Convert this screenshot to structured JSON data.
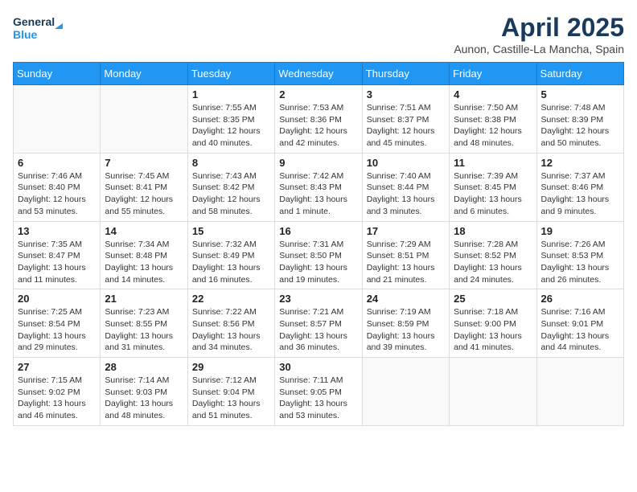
{
  "header": {
    "logo_line1": "General",
    "logo_line2": "Blue",
    "month": "April 2025",
    "location": "Aunon, Castille-La Mancha, Spain"
  },
  "days_of_week": [
    "Sunday",
    "Monday",
    "Tuesday",
    "Wednesday",
    "Thursday",
    "Friday",
    "Saturday"
  ],
  "weeks": [
    [
      {
        "day": "",
        "info": ""
      },
      {
        "day": "",
        "info": ""
      },
      {
        "day": "1",
        "info": "Sunrise: 7:55 AM\nSunset: 8:35 PM\nDaylight: 12 hours and 40 minutes."
      },
      {
        "day": "2",
        "info": "Sunrise: 7:53 AM\nSunset: 8:36 PM\nDaylight: 12 hours and 42 minutes."
      },
      {
        "day": "3",
        "info": "Sunrise: 7:51 AM\nSunset: 8:37 PM\nDaylight: 12 hours and 45 minutes."
      },
      {
        "day": "4",
        "info": "Sunrise: 7:50 AM\nSunset: 8:38 PM\nDaylight: 12 hours and 48 minutes."
      },
      {
        "day": "5",
        "info": "Sunrise: 7:48 AM\nSunset: 8:39 PM\nDaylight: 12 hours and 50 minutes."
      }
    ],
    [
      {
        "day": "6",
        "info": "Sunrise: 7:46 AM\nSunset: 8:40 PM\nDaylight: 12 hours and 53 minutes."
      },
      {
        "day": "7",
        "info": "Sunrise: 7:45 AM\nSunset: 8:41 PM\nDaylight: 12 hours and 55 minutes."
      },
      {
        "day": "8",
        "info": "Sunrise: 7:43 AM\nSunset: 8:42 PM\nDaylight: 12 hours and 58 minutes."
      },
      {
        "day": "9",
        "info": "Sunrise: 7:42 AM\nSunset: 8:43 PM\nDaylight: 13 hours and 1 minute."
      },
      {
        "day": "10",
        "info": "Sunrise: 7:40 AM\nSunset: 8:44 PM\nDaylight: 13 hours and 3 minutes."
      },
      {
        "day": "11",
        "info": "Sunrise: 7:39 AM\nSunset: 8:45 PM\nDaylight: 13 hours and 6 minutes."
      },
      {
        "day": "12",
        "info": "Sunrise: 7:37 AM\nSunset: 8:46 PM\nDaylight: 13 hours and 9 minutes."
      }
    ],
    [
      {
        "day": "13",
        "info": "Sunrise: 7:35 AM\nSunset: 8:47 PM\nDaylight: 13 hours and 11 minutes."
      },
      {
        "day": "14",
        "info": "Sunrise: 7:34 AM\nSunset: 8:48 PM\nDaylight: 13 hours and 14 minutes."
      },
      {
        "day": "15",
        "info": "Sunrise: 7:32 AM\nSunset: 8:49 PM\nDaylight: 13 hours and 16 minutes."
      },
      {
        "day": "16",
        "info": "Sunrise: 7:31 AM\nSunset: 8:50 PM\nDaylight: 13 hours and 19 minutes."
      },
      {
        "day": "17",
        "info": "Sunrise: 7:29 AM\nSunset: 8:51 PM\nDaylight: 13 hours and 21 minutes."
      },
      {
        "day": "18",
        "info": "Sunrise: 7:28 AM\nSunset: 8:52 PM\nDaylight: 13 hours and 24 minutes."
      },
      {
        "day": "19",
        "info": "Sunrise: 7:26 AM\nSunset: 8:53 PM\nDaylight: 13 hours and 26 minutes."
      }
    ],
    [
      {
        "day": "20",
        "info": "Sunrise: 7:25 AM\nSunset: 8:54 PM\nDaylight: 13 hours and 29 minutes."
      },
      {
        "day": "21",
        "info": "Sunrise: 7:23 AM\nSunset: 8:55 PM\nDaylight: 13 hours and 31 minutes."
      },
      {
        "day": "22",
        "info": "Sunrise: 7:22 AM\nSunset: 8:56 PM\nDaylight: 13 hours and 34 minutes."
      },
      {
        "day": "23",
        "info": "Sunrise: 7:21 AM\nSunset: 8:57 PM\nDaylight: 13 hours and 36 minutes."
      },
      {
        "day": "24",
        "info": "Sunrise: 7:19 AM\nSunset: 8:59 PM\nDaylight: 13 hours and 39 minutes."
      },
      {
        "day": "25",
        "info": "Sunrise: 7:18 AM\nSunset: 9:00 PM\nDaylight: 13 hours and 41 minutes."
      },
      {
        "day": "26",
        "info": "Sunrise: 7:16 AM\nSunset: 9:01 PM\nDaylight: 13 hours and 44 minutes."
      }
    ],
    [
      {
        "day": "27",
        "info": "Sunrise: 7:15 AM\nSunset: 9:02 PM\nDaylight: 13 hours and 46 minutes."
      },
      {
        "day": "28",
        "info": "Sunrise: 7:14 AM\nSunset: 9:03 PM\nDaylight: 13 hours and 48 minutes."
      },
      {
        "day": "29",
        "info": "Sunrise: 7:12 AM\nSunset: 9:04 PM\nDaylight: 13 hours and 51 minutes."
      },
      {
        "day": "30",
        "info": "Sunrise: 7:11 AM\nSunset: 9:05 PM\nDaylight: 13 hours and 53 minutes."
      },
      {
        "day": "",
        "info": ""
      },
      {
        "day": "",
        "info": ""
      },
      {
        "day": "",
        "info": ""
      }
    ]
  ]
}
